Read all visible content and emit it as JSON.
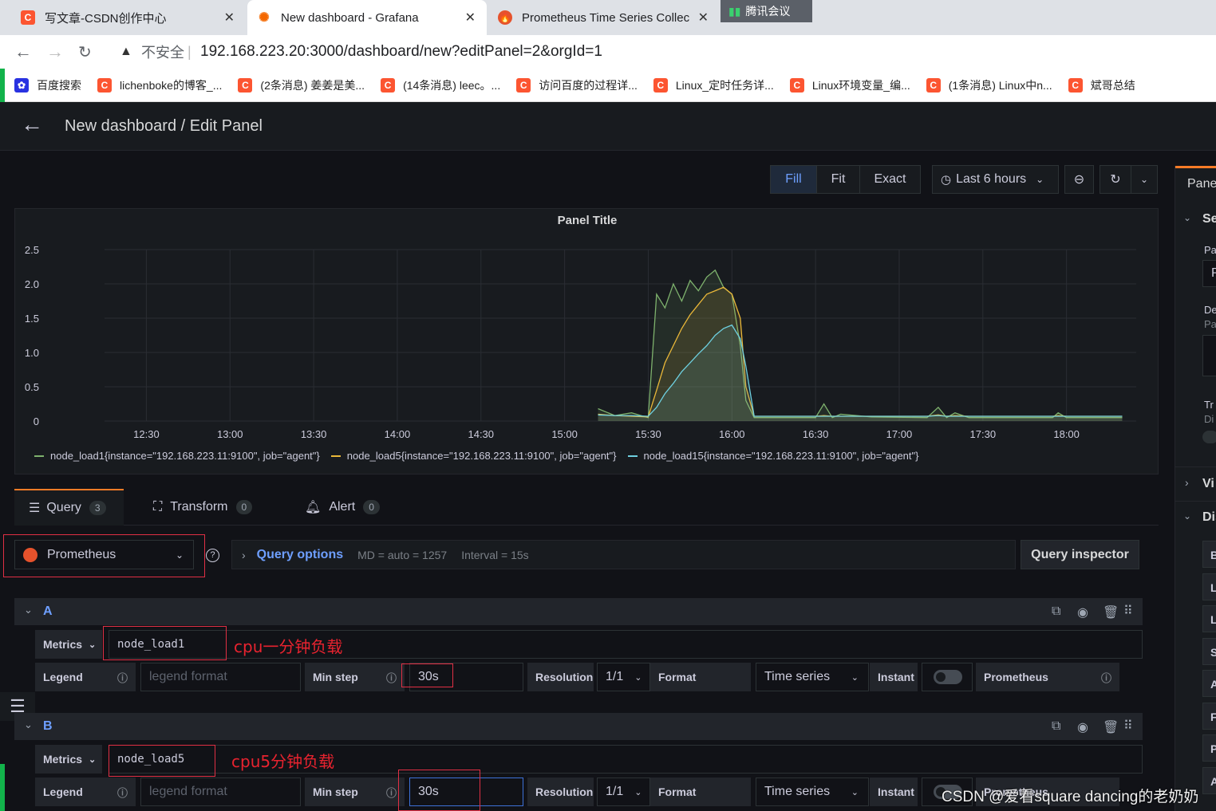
{
  "browser": {
    "tabs": [
      {
        "title": "写文章-CSDN创作中心",
        "icon": "csdn-icon"
      },
      {
        "title": "New dashboard - Grafana",
        "icon": "grafana-icon"
      },
      {
        "title": "Prometheus Time Series Collec",
        "icon": "prometheus-icon"
      }
    ],
    "tencent": "腾讯会议",
    "security": "不安全",
    "url": "192.168.223.20:3000/dashboard/new?editPanel=2&orgId=1",
    "bookmarks": [
      "百度搜索",
      "lichenboke的博客_...",
      "(2条消息) 姜姜是美...",
      "(14条消息) leec。...",
      "访问百度的过程详...",
      "Linux_定时任务详...",
      "Linux环境变量_编...",
      "(1条消息) Linux中n...",
      "斌哥总结"
    ]
  },
  "header": {
    "title": "New dashboard / Edit Panel"
  },
  "toolbar": {
    "fill": "Fill",
    "fit": "Fit",
    "exact": "Exact",
    "time_range": "Last 6 hours"
  },
  "panel": {
    "title": "Panel Title"
  },
  "chart_data": {
    "type": "line",
    "title": "Panel Title",
    "y_ticks": [
      "2.5",
      "2.0",
      "1.5",
      "1.0",
      "0.5",
      "0"
    ],
    "x_ticks": [
      "12:30",
      "13:00",
      "13:30",
      "14:00",
      "14:30",
      "15:00",
      "15:30",
      "16:00",
      "16:30",
      "17:00",
      "17:30",
      "18:00"
    ],
    "ylim": [
      0,
      2.5
    ],
    "xlim": [
      "12:15",
      "18:25"
    ],
    "grid": true,
    "legend_position": "bottom",
    "x": [
      "15:12",
      "15:18",
      "15:24",
      "15:30",
      "15:33",
      "15:36",
      "15:39",
      "15:42",
      "15:45",
      "15:48",
      "15:51",
      "15:54",
      "15:57",
      "16:00",
      "16:03",
      "16:05",
      "16:08",
      "16:30",
      "16:33",
      "16:36",
      "16:39",
      "16:50",
      "17:10",
      "17:14",
      "17:17",
      "17:20",
      "17:25",
      "17:40",
      "17:55",
      "17:57",
      "18:00",
      "18:10",
      "18:20"
    ],
    "series": [
      {
        "name": "node_load1{instance=\"192.168.223.11:9100\", job=\"agent\"}",
        "color": "#7eb26d",
        "values": [
          0.18,
          0.08,
          0.12,
          0.05,
          1.85,
          1.65,
          2.0,
          1.75,
          2.05,
          1.9,
          2.1,
          2.2,
          1.95,
          1.85,
          1.1,
          0.3,
          0.05,
          0.05,
          0.25,
          0.05,
          0.1,
          0.06,
          0.05,
          0.2,
          0.05,
          0.12,
          0.05,
          0.05,
          0.05,
          0.12,
          0.05,
          0.05,
          0.05
        ]
      },
      {
        "name": "node_load5{instance=\"192.168.223.11:9100\", job=\"agent\"}",
        "color": "#eab839",
        "values": [
          0.1,
          0.08,
          0.07,
          0.06,
          0.45,
          0.85,
          1.1,
          1.35,
          1.55,
          1.7,
          1.85,
          1.9,
          1.95,
          1.85,
          1.5,
          0.5,
          0.07,
          0.07,
          0.08,
          0.07,
          0.07,
          0.07,
          0.07,
          0.09,
          0.07,
          0.08,
          0.07,
          0.07,
          0.07,
          0.08,
          0.07,
          0.07,
          0.07
        ]
      },
      {
        "name": "node_load15{instance=\"192.168.223.11:9100\", job=\"agent\"}",
        "color": "#6ed0e0",
        "values": [
          0.09,
          0.08,
          0.08,
          0.07,
          0.2,
          0.4,
          0.55,
          0.72,
          0.85,
          0.98,
          1.1,
          1.25,
          1.35,
          1.4,
          1.2,
          0.8,
          0.07,
          0.07,
          0.07,
          0.07,
          0.07,
          0.07,
          0.07,
          0.08,
          0.07,
          0.07,
          0.07,
          0.07,
          0.07,
          0.07,
          0.07,
          0.07,
          0.07
        ]
      }
    ]
  },
  "query_tabs": [
    {
      "label": "Query",
      "count": "3"
    },
    {
      "label": "Transform",
      "count": "0"
    },
    {
      "label": "Alert",
      "count": "0"
    }
  ],
  "datasource": {
    "name": "Prometheus"
  },
  "query_options": {
    "label": "Query options",
    "md": "MD = auto = 1257",
    "interval": "Interval = 15s",
    "inspector": "Query inspector"
  },
  "queries": [
    {
      "ref": "A",
      "metrics_label": "Metrics",
      "metric": "node_load1",
      "annotation": "cpu一分钟负载",
      "legend_label": "Legend",
      "legend_placeholder": "legend format",
      "min_step_label": "Min step",
      "min_step": "30s",
      "resolution_label": "Resolution",
      "resolution": "1/1",
      "format_label": "Format",
      "format": "Time series",
      "instant_label": "Instant",
      "ds_label": "Prometheus"
    },
    {
      "ref": "B",
      "metrics_label": "Metrics",
      "metric": "node_load5",
      "annotation": "cpu5分钟负载",
      "legend_label": "Legend",
      "legend_placeholder": "legend format",
      "min_step_label": "Min step",
      "min_step": "30s",
      "resolution_label": "Resolution",
      "resolution": "1/1",
      "format_label": "Format",
      "format": "Time series",
      "instant_label": "Instant",
      "ds_label": "Prometheus"
    }
  ],
  "side": {
    "panel": "Pane",
    "se": "Se",
    "pa": "Pa",
    "p": "P",
    "de": "De",
    "pa2": "Pa",
    "tr": "Tr",
    "di": "Di",
    "vi": "Vi",
    "dis": "Dis",
    "letters": [
      "B",
      "L",
      "L",
      "S",
      "A",
      "F",
      "P",
      "A"
    ]
  },
  "watermark": "CSDN @爱看square dancing的老奶奶"
}
